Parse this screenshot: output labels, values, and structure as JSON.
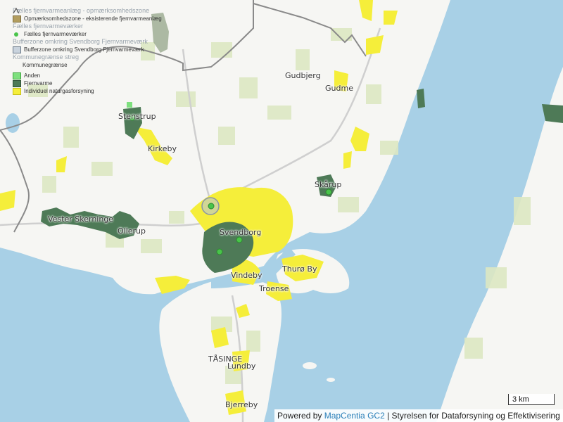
{
  "legend": {
    "group1_title": "Fælles fjernvarmeanlæg - opmærksomhedszone",
    "group1_item": "Opmærksomhedszone - eksisterende fjernvarmeanlæg",
    "group2_title": "Fælles fjernvarmeværker",
    "group2_item": "Fælles fjernvarmeværker",
    "group3_title": "Bufferzone omkring Svendborg Fjernvarmeværk",
    "group3_item": "Bufferzone omkring Svendborg Fjernvarmeværk",
    "group4_title": "Kommunegrænse streg",
    "group4_item": "Kommunegrænse",
    "item_anden": "Anden",
    "item_fjernvarme": "Fjernvarme",
    "item_naturgas": "Individuel naturgasforsyning"
  },
  "places": {
    "gudbjerg": "Gudbjerg",
    "gudme": "Gudme",
    "stenstrup": "Stenstrup",
    "kirkeby": "Kirkeby",
    "skaarup": "Skårup",
    "vester_skerninge": "Vester Skerninge",
    "ollerup": "Ollerup",
    "svendborg": "Svendborg",
    "thuro_by": "Thurø By",
    "vindeby": "Vindeby",
    "troense": "Troense",
    "taasinge": "TÅSINGE",
    "lundby": "Lundby",
    "bjerreby": "Bjerreby"
  },
  "scale_label": "3 km",
  "attribution": {
    "prefix": "Powered by ",
    "link": "MapCentia GC2",
    "suffix": " | Styrelsen for Dataforsyning og Effektivisering"
  },
  "colors": {
    "water": "#a8d0e6",
    "land": "#f6f6f3",
    "field": "#dde8c3",
    "natural_gas": "#f5ee3a",
    "district_heating": "#4e7a57",
    "other": "#7ee07e",
    "plant": "#49c44a",
    "border": "#8a8a8a"
  }
}
